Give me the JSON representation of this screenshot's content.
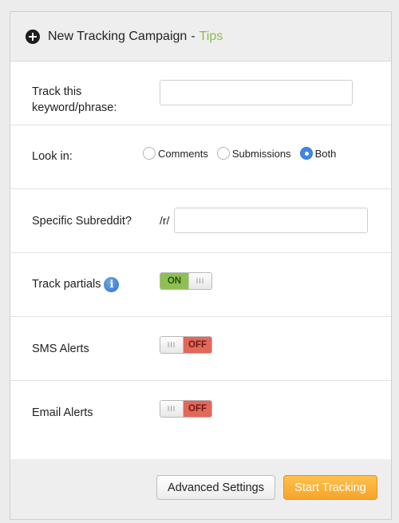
{
  "header": {
    "title": "New Tracking Campaign",
    "separator": "-",
    "tips_link": "Tips",
    "icon": "plus-circle-icon"
  },
  "keyword": {
    "label_line1": "Track this",
    "label_line2": "keyword/phrase:",
    "value": "",
    "placeholder": ""
  },
  "look_in": {
    "label": "Look in:",
    "options": [
      {
        "label": "Comments",
        "checked": false
      },
      {
        "label": "Submissions",
        "checked": false
      },
      {
        "label": "Both",
        "checked": true
      }
    ]
  },
  "subreddit": {
    "label": "Specific Subreddit?",
    "prefix": "/r/",
    "value": "",
    "placeholder": ""
  },
  "track_partials": {
    "label": "Track partials",
    "icon": "info-icon",
    "state": "ON",
    "knob_grip": "III"
  },
  "sms_alerts": {
    "label": "SMS Alerts",
    "state": "OFF",
    "knob_grip": "III"
  },
  "email_alerts": {
    "label": "Email Alerts",
    "state": "OFF",
    "knob_grip": "III"
  },
  "footer": {
    "advanced_label": "Advanced Settings",
    "start_label": "Start Tracking"
  },
  "colors": {
    "accent_green": "#8cbc4a",
    "toggle_on": "#8cc152",
    "toggle_off": "#e2685a",
    "primary_button": "#f7a52a",
    "radio_selected": "#3f86e8"
  }
}
